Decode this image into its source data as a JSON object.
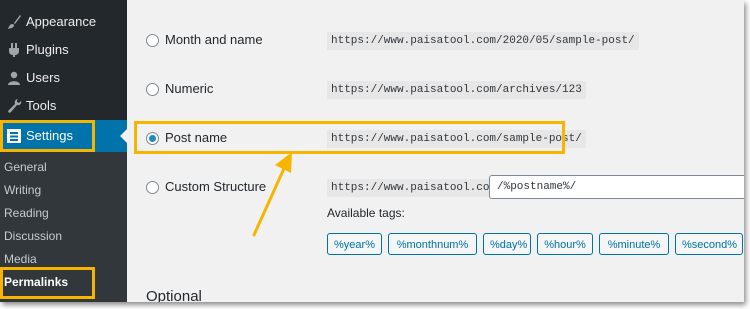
{
  "sidebar": {
    "items": [
      {
        "label": "Appearance",
        "icon": "paintbrush-icon"
      },
      {
        "label": "Plugins",
        "icon": "plug-icon"
      },
      {
        "label": "Users",
        "icon": "users-icon"
      },
      {
        "label": "Tools",
        "icon": "wrench-icon"
      },
      {
        "label": "Settings",
        "icon": "settings-icon"
      }
    ],
    "submenu": [
      "General",
      "Writing",
      "Reading",
      "Discussion",
      "Media",
      "Permalinks"
    ]
  },
  "permalink_options": [
    {
      "label": "Month and name",
      "example": "https://www.paisatool.com/2020/05/sample-post/",
      "selected": false
    },
    {
      "label": "Numeric",
      "example": "https://www.paisatool.com/archives/123",
      "selected": false
    },
    {
      "label": "Post name",
      "example": "https://www.paisatool.com/sample-post/",
      "selected": true
    },
    {
      "label": "Custom Structure",
      "example": "https://www.paisatool.com",
      "selected": false
    }
  ],
  "custom_structure_value": "/%postname%/",
  "available_tags_label": "Available tags:",
  "tags": [
    "%year%",
    "%monthnum%",
    "%day%",
    "%hour%",
    "%minute%",
    "%second%"
  ],
  "optional_heading": "Optional",
  "colors": {
    "sidebar_bg": "#23282d",
    "submenu_bg": "#32373c",
    "settings_active": "#0073aa",
    "highlight_annotation": "#f7b500",
    "radio_checked": "#1e8cbe",
    "tag_button_border": "#0071a1",
    "content_bg": "#f1f1f1"
  }
}
